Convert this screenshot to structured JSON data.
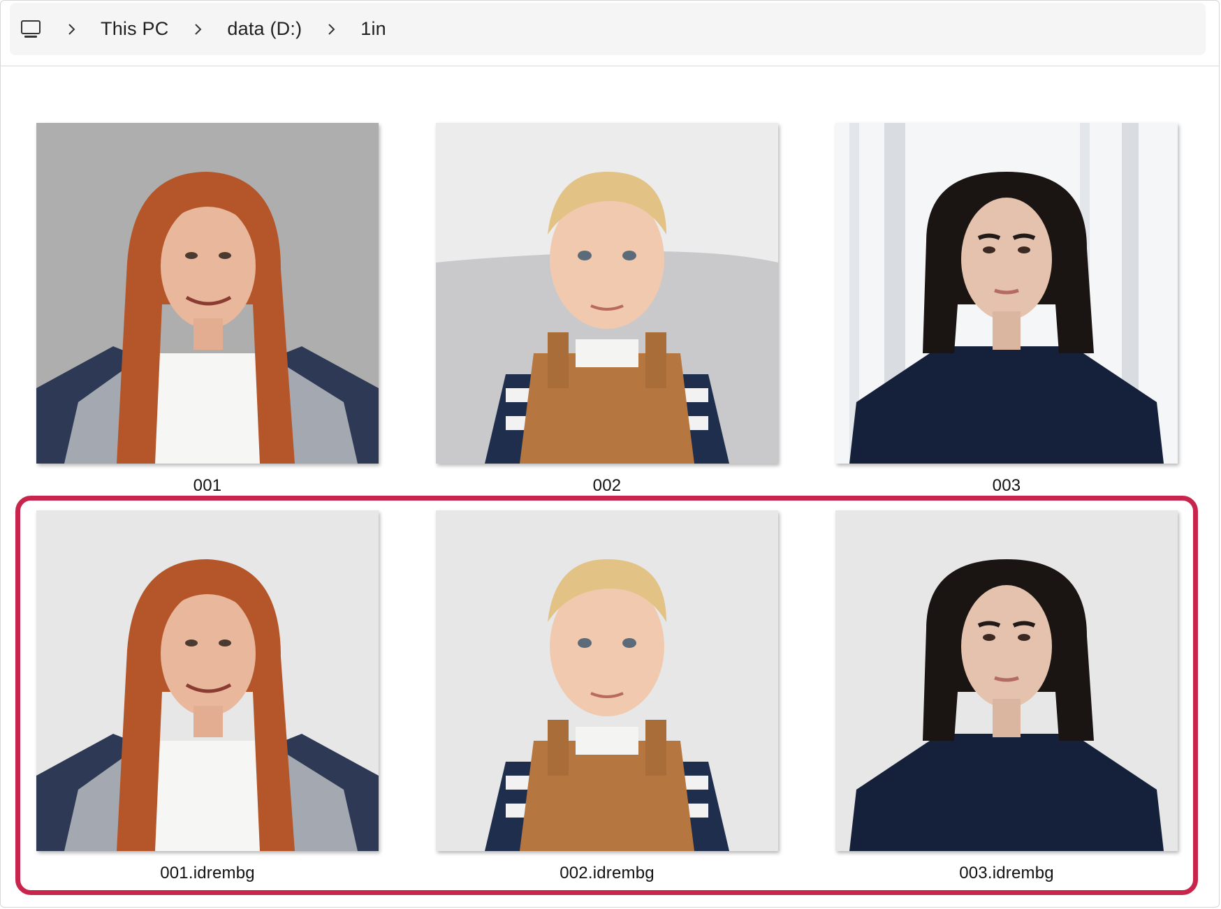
{
  "breadcrumb": {
    "root_icon": "computer-icon",
    "items": [
      "This PC",
      "data (D:)",
      "1in"
    ]
  },
  "files": [
    {
      "name": "001",
      "subject": "red-haired woman in plaid shirt",
      "background": "grey wall"
    },
    {
      "name": "002",
      "subject": "blond toddler in overalls",
      "background": "grey couch"
    },
    {
      "name": "003",
      "subject": "dark-haired woman in navy shirt",
      "background": "bright window"
    },
    {
      "name": "001.idrembg",
      "subject": "red-haired woman in plaid shirt",
      "background": "plain light grey"
    },
    {
      "name": "002.idrembg",
      "subject": "blond toddler in overalls",
      "background": "plain light grey"
    },
    {
      "name": "003.idrembg",
      "subject": "dark-haired woman in navy shirt",
      "background": "plain light grey"
    }
  ],
  "colors": {
    "highlight": "#c8254d",
    "address_bar_bg": "#f5f5f5"
  }
}
